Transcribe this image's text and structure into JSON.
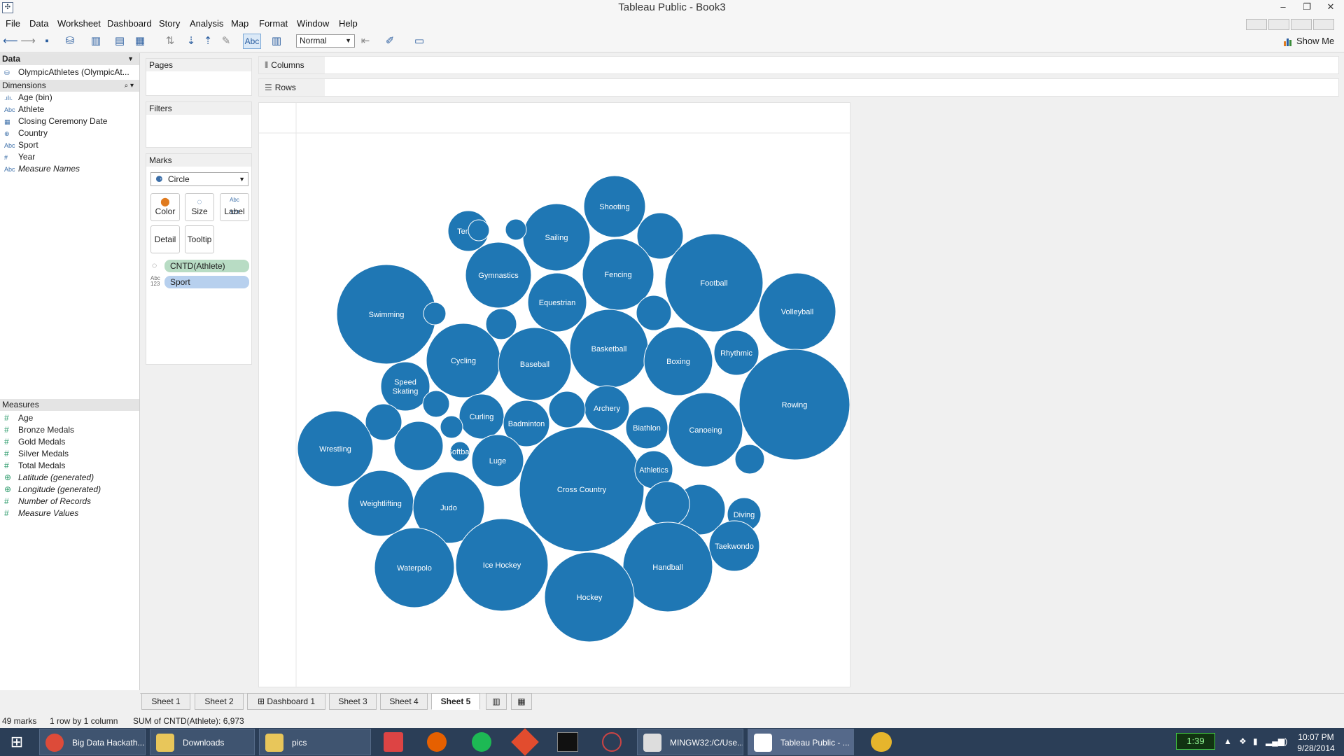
{
  "window": {
    "title": "Tableau Public - Book3"
  },
  "menu": [
    "File",
    "Data",
    "Worksheet",
    "Dashboard",
    "Story",
    "Analysis",
    "Map",
    "Format",
    "Window",
    "Help"
  ],
  "toolbar": {
    "abc_label": "Abc",
    "fit_value": "Normal",
    "show_me_label": "Show Me"
  },
  "data_panel": {
    "header": "Data",
    "datasource": "OlympicAthletes (OlympicAt...",
    "dimensions_label": "Dimensions",
    "dimensions": [
      {
        "type": ".ılı.",
        "name": "Age (bin)",
        "italic": false
      },
      {
        "type": "Abc",
        "name": "Athlete",
        "italic": false
      },
      {
        "type": "▦",
        "name": "Closing Ceremony Date",
        "italic": false
      },
      {
        "type": "⊕",
        "name": "Country",
        "italic": false
      },
      {
        "type": "Abc",
        "name": "Sport",
        "italic": false
      },
      {
        "type": "#",
        "name": "Year",
        "italic": false
      },
      {
        "type": "Abc",
        "name": "Measure Names",
        "italic": true
      }
    ],
    "measures_label": "Measures",
    "measures": [
      {
        "type": "#",
        "name": "Age",
        "italic": false
      },
      {
        "type": "#",
        "name": "Bronze Medals",
        "italic": false
      },
      {
        "type": "#",
        "name": "Gold Medals",
        "italic": false
      },
      {
        "type": "#",
        "name": "Silver Medals",
        "italic": false
      },
      {
        "type": "#",
        "name": "Total Medals",
        "italic": false
      },
      {
        "type": "⊕",
        "name": "Latitude (generated)",
        "italic": true
      },
      {
        "type": "⊕",
        "name": "Longitude (generated)",
        "italic": true
      },
      {
        "type": "#",
        "name": "Number of Records",
        "italic": true
      },
      {
        "type": "#",
        "name": "Measure Values",
        "italic": true
      }
    ]
  },
  "cards": {
    "pages": "Pages",
    "filters": "Filters",
    "marks": "Marks",
    "mark_type": "Circle",
    "buttons": {
      "color": "Color",
      "size": "Size",
      "label": "Label",
      "detail": "Detail",
      "tooltip": "Tooltip",
      "label_icon": "Abc\n123"
    },
    "pill_size": "CNTD(Athlete)",
    "pill_label": "Sport",
    "pill_size_color": "#b8dcc4",
    "pill_label_color": "#b7d0ee"
  },
  "shelves": {
    "columns": "Columns",
    "rows": "Rows"
  },
  "tabs": [
    "Sheet 1",
    "Sheet 2",
    "Dashboard 1",
    "Sheet 3",
    "Sheet 4",
    "Sheet 5"
  ],
  "active_tab": "Sheet 5",
  "status": {
    "marks": "49 marks",
    "layout": "1 row by 1 column",
    "sum": "SUM of CNTD(Athlete): 6,973"
  },
  "taskbar": {
    "items": [
      "Big Data Hackath...",
      "Downloads",
      "pics",
      "MINGW32:/C/Use...",
      "Tableau Public - ..."
    ],
    "battery": "1:39",
    "time": "10:07 PM",
    "date": "9/28/2014"
  },
  "chart_data": {
    "type": "packed-bubble",
    "measure": "CNTD(Athlete)",
    "dimension": "Sport",
    "color": "#1f77b4",
    "bubbles": [
      {
        "label": "Shooting"
      },
      {
        "label": "Sailing"
      },
      {
        "label": "Tennis"
      },
      {
        "label": ""
      },
      {
        "label": ""
      },
      {
        "label": ""
      },
      {
        "label": "Gymnastics"
      },
      {
        "label": "Fencing"
      },
      {
        "label": "Football"
      },
      {
        "label": "Volleyball"
      },
      {
        "label": "Equestrian"
      },
      {
        "label": ""
      },
      {
        "label": "Swimming"
      },
      {
        "label": ""
      },
      {
        "label": ""
      },
      {
        "label": "Basketball"
      },
      {
        "label": "Cycling"
      },
      {
        "label": "Baseball"
      },
      {
        "label": "Boxing"
      },
      {
        "label": "Rhythmic"
      },
      {
        "label": "Rowing"
      },
      {
        "label": "Speed Skating"
      },
      {
        "label": ""
      },
      {
        "label": "Archery"
      },
      {
        "label": "Curling"
      },
      {
        "label": "Badminton"
      },
      {
        "label": ""
      },
      {
        "label": ""
      },
      {
        "label": "Biathlon"
      },
      {
        "label": "Canoeing"
      },
      {
        "label": "Wrestling"
      },
      {
        "label": ""
      },
      {
        "label": ""
      },
      {
        "label": "Softball"
      },
      {
        "label": "Luge"
      },
      {
        "label": "Cross Country"
      },
      {
        "label": "Athletics"
      },
      {
        "label": ""
      },
      {
        "label": ""
      },
      {
        "label": "Diving"
      },
      {
        "label": "Weightlifting"
      },
      {
        "label": "Judo"
      },
      {
        "label": ""
      },
      {
        "label": "Taekwondo"
      },
      {
        "label": "Waterpolo"
      },
      {
        "label": "Ice Hockey"
      },
      {
        "label": "Handball"
      },
      {
        "label": "Hockey"
      },
      {
        "label": ""
      }
    ]
  }
}
